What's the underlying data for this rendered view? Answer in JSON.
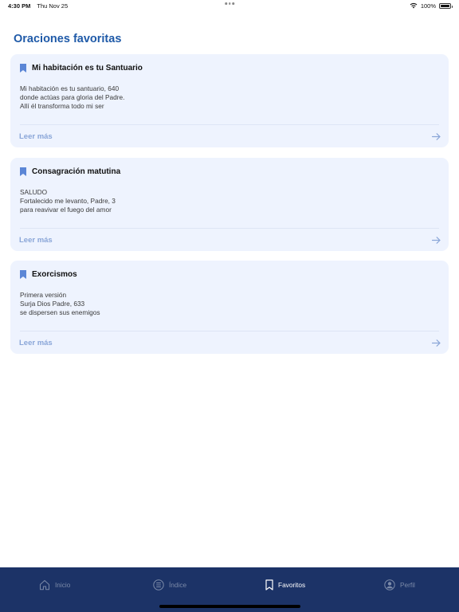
{
  "status_bar": {
    "time": "4:30 PM",
    "date": "Thu Nov 25",
    "battery": "100%",
    "icons": [
      "wifi-icon",
      "battery-icon"
    ]
  },
  "page": {
    "title": "Oraciones favoritas"
  },
  "cards": [
    {
      "title": "Mi habitación es tu Santuario",
      "lines": [
        "Mi habitación es tu santuario, 640",
        "donde actúas para gloria del Padre.",
        "Allí él transforma todo mi ser"
      ],
      "read_more": "Leer más"
    },
    {
      "title": "Consagración matutina",
      "lines": [
        "SALUDO",
        "Fortalecido me levanto, Padre, 3",
        "para reavivar el fuego del amor"
      ],
      "read_more": "Leer más"
    },
    {
      "title": "Exorcismos",
      "lines": [
        "Primera versión",
        "Surja Dios Padre, 633",
        "se dispersen sus enemigos"
      ],
      "read_more": "Leer más"
    }
  ],
  "tab_bar": {
    "tabs": [
      {
        "label": "Inicio",
        "icon": "home-icon",
        "active": false
      },
      {
        "label": "Índice",
        "icon": "list-icon",
        "active": false
      },
      {
        "label": "Favoritos",
        "icon": "bookmark-icon",
        "active": true
      },
      {
        "label": "Perfil",
        "icon": "profile-icon",
        "active": false
      }
    ]
  },
  "colors": {
    "accent": "#1f5aa8",
    "card_bg": "#eef3fe",
    "tab_bar_bg": "#1c3367",
    "read_more": "#8aa6d8",
    "bookmark": "#5b86d6"
  }
}
